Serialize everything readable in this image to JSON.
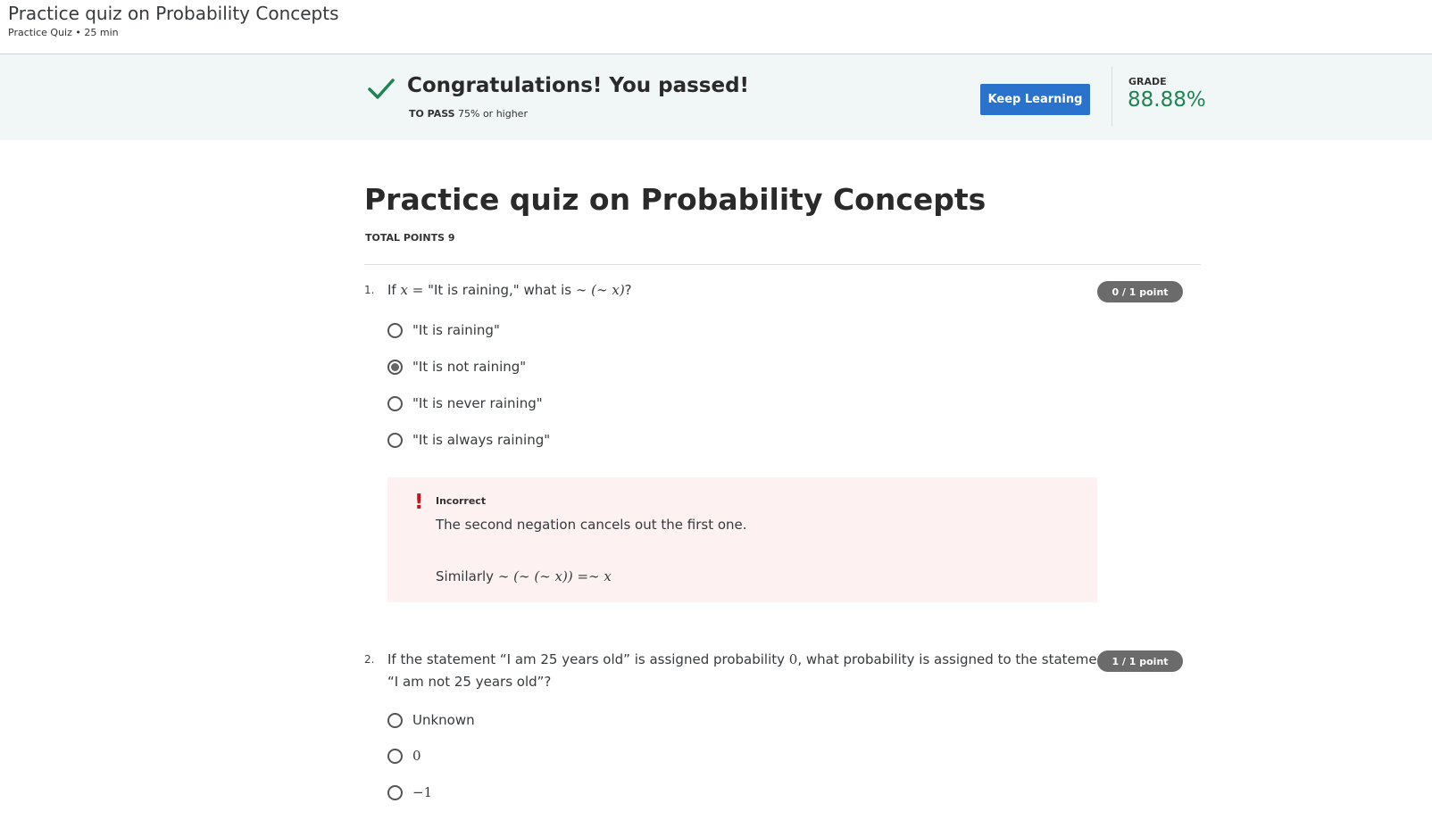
{
  "header": {
    "title": "Practice quiz on Probability Concepts",
    "subtitle": "Practice Quiz • 25 min"
  },
  "banner": {
    "message": "Congratulations! You passed!",
    "to_pass_label": "TO PASS",
    "to_pass_value": "75% or higher",
    "keep_learning_label": "Keep Learning",
    "grade_label": "GRADE",
    "grade_value": "88.88%",
    "icon": "check-icon",
    "accent_color": "#1f8354",
    "button_color": "#2a73cc"
  },
  "quiz": {
    "title": "Practice quiz on Probability Concepts",
    "total_points": "TOTAL POINTS 9"
  },
  "questions": [
    {
      "number": "1.",
      "text_prefix": "If ",
      "text_math1": "x",
      "text_mid1": " = ",
      "text_mid2": "\"It is raining,\" what is ",
      "text_math2": "∼ (∼ x)",
      "text_suffix": "?",
      "points": "0 / 1 point",
      "options": [
        {
          "label": "\"It is raining\"",
          "selected": false
        },
        {
          "label": "\"It is not raining\"",
          "selected": true
        },
        {
          "label": "\"It is never raining\"",
          "selected": false
        },
        {
          "label": "\"It is always raining\"",
          "selected": false
        }
      ],
      "feedback": {
        "icon": "exclamation-icon",
        "status": "Incorrect",
        "line1": "The second negation cancels out the first one.",
        "line2_prefix": "Similarly ",
        "line2_math": "∼ (∼ (∼ x)) =∼ x",
        "color": "#c4161c"
      }
    },
    {
      "number": "2.",
      "line1_prefix": "If the statement “I am 25 years old” is assigned probability ",
      "line1_math": "0",
      "line1_suffix": ", what probability is assigned to the statement",
      "line2": "“I am not 25 years old”?",
      "points": "1 / 1 point",
      "options": [
        {
          "label": "Unknown",
          "selected": false
        },
        {
          "label": "0",
          "selected": false
        },
        {
          "label": "−1",
          "selected": false
        }
      ]
    }
  ]
}
